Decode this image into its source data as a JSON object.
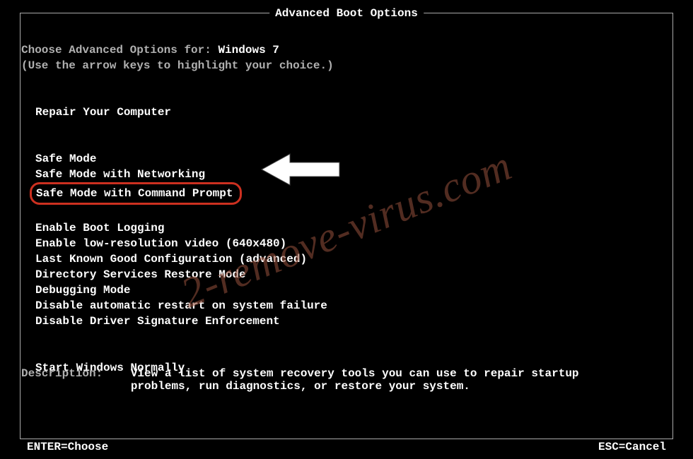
{
  "title": "Advanced Boot Options",
  "header": {
    "prompt_prefix": "Choose Advanced Options for: ",
    "os_name": "Windows 7",
    "hint": "(Use the arrow keys to highlight your choice.)"
  },
  "menu": {
    "group1": [
      "Repair Your Computer"
    ],
    "group2": [
      "Safe Mode",
      "Safe Mode with Networking",
      "Safe Mode with Command Prompt"
    ],
    "group3": [
      "Enable Boot Logging",
      "Enable low-resolution video (640x480)",
      "Last Known Good Configuration (advanced)",
      "Directory Services Restore Mode",
      "Debugging Mode",
      "Disable automatic restart on system failure",
      "Disable Driver Signature Enforcement"
    ],
    "group4": [
      "Start Windows Normally"
    ],
    "highlighted_item": "Safe Mode with Command Prompt"
  },
  "description": {
    "label": "Description:",
    "text": "View a list of system recovery tools you can use to repair startup problems, run diagnostics, or restore your system."
  },
  "footer": {
    "left": "ENTER=Choose",
    "right": "ESC=Cancel"
  },
  "watermark": "2-remove-virus.com",
  "annotation": {
    "arrow_color": "#ffffff",
    "highlight_color": "#cc3020"
  }
}
